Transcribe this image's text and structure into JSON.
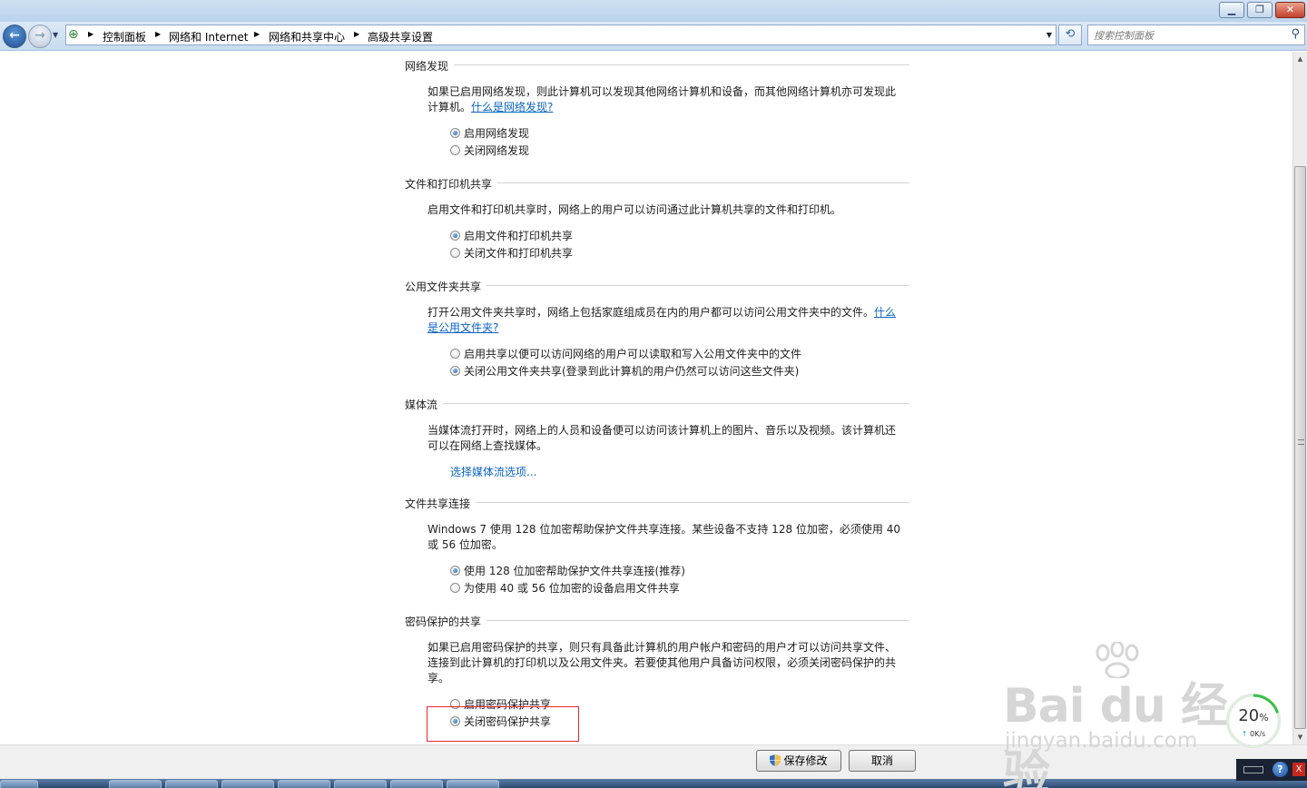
{
  "window": {
    "minimize_icon": "minimize-icon",
    "maximize_icon": "restore-icon",
    "close_icon": "close-icon"
  },
  "navbar": {
    "breadcrumbs": [
      "控制面板",
      "网络和 Internet",
      "网络和共享中心",
      "高级共享设置"
    ],
    "search_placeholder": "搜索控制面板"
  },
  "sections": {
    "discovery": {
      "title": "网络发现",
      "desc_line1": "如果已启用网络发现，则此计算机可以发现其他网络计算机和设备，而其他网络计算机亦可发现此",
      "desc_line2": "计算机。",
      "link": "什么是网络发现?",
      "options": [
        "启用网络发现",
        "关闭网络发现"
      ],
      "selected": 0
    },
    "file_print": {
      "title": "文件和打印机共享",
      "desc": "启用文件和打印机共享时，网络上的用户可以访问通过此计算机共享的文件和打印机。",
      "options": [
        "启用文件和打印机共享",
        "关闭文件和打印机共享"
      ],
      "selected": 0
    },
    "public_folder": {
      "title": "公用文件夹共享",
      "desc_line1": "打开公用文件夹共享时，网络上包括家庭组成员在内的用户都可以访问公用文件夹中的文件。",
      "link_part1": "什么",
      "link_part2": "是公用文件夹?",
      "options": [
        "启用共享以便可以访问网络的用户可以读取和写入公用文件夹中的文件",
        "关闭公用文件夹共享(登录到此计算机的用户仍然可以访问这些文件夹)"
      ],
      "selected": 1
    },
    "media": {
      "title": "媒体流",
      "desc_line1": "当媒体流打开时，网络上的人员和设备便可以访问该计算机上的图片、音乐以及视频。该计算机还",
      "desc_line2": "可以在网络上查找媒体。",
      "link": "选择媒体流选项..."
    },
    "connection": {
      "title": "文件共享连接",
      "desc_line1": "Windows 7 使用 128 位加密帮助保护文件共享连接。某些设备不支持 128 位加密，必须使用 40",
      "desc_line2": "或 56 位加密。",
      "options": [
        "使用 128 位加密帮助保护文件共享连接(推荐)",
        "为使用 40 或 56 位加密的设备启用文件共享"
      ],
      "selected": 0
    },
    "password": {
      "title": "密码保护的共享",
      "desc_line1": "如果已启用密码保护的共享，则只有具备此计算机的用户帐户和密码的用户才可以访问共享文件、",
      "desc_line2": "连接到此计算机的打印机以及公用文件夹。若要使其他用户具备访问权限，必须关闭密码保护的共",
      "desc_line3": "享。",
      "options": [
        "启用密码保护共享",
        "关闭密码保护共享"
      ],
      "selected": 1
    }
  },
  "footer": {
    "save_label": "保存修改",
    "cancel_label": "取消"
  },
  "overlays": {
    "watermark_logo": "Bai du 经验",
    "watermark_url": "jingyan.baidu.com",
    "speed_percent": "20",
    "speed_unit": "%",
    "speed_rate": "0K/s",
    "help_label": "?",
    "tray_close": "X"
  },
  "colors": {
    "link": "#0b63c5",
    "highlight_box": "#e8242b"
  }
}
